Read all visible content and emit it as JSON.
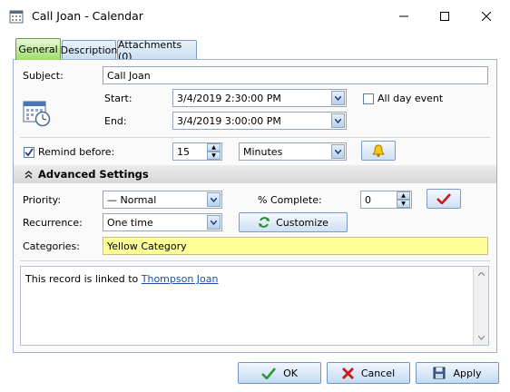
{
  "window": {
    "title": "Call Joan - Calendar"
  },
  "tabs": [
    {
      "label": "General",
      "active": true
    },
    {
      "label": "Description",
      "active": false
    },
    {
      "label": "Attachments (0)",
      "active": false
    }
  ],
  "general": {
    "subject_label": "Subject:",
    "subject_value": "Call Joan",
    "start_label": "Start:",
    "start_value": "3/4/2019 2:30:00 PM",
    "end_label": "End:",
    "end_value": "3/4/2019 3:00:00 PM",
    "all_day_label": "All day event",
    "all_day_checked": false,
    "remind_label": "Remind before:",
    "remind_checked": true,
    "remind_value": "15",
    "remind_unit": "Minutes"
  },
  "advanced": {
    "title": "Advanced Settings",
    "priority_label": "Priority:",
    "priority_value": "—  Normal",
    "percent_label": "% Complete:",
    "percent_value": "0",
    "recurrence_label": "Recurrence:",
    "recurrence_value": "One time",
    "customize_label": "Customize",
    "categories_label": "Categories:",
    "categories_value": "Yellow Category",
    "categories_color": "#ffff99"
  },
  "notes": {
    "prefix": "This record is linked to ",
    "link_text": "Thompson Joan"
  },
  "buttons": {
    "ok": "OK",
    "cancel": "Cancel",
    "apply": "Apply"
  }
}
